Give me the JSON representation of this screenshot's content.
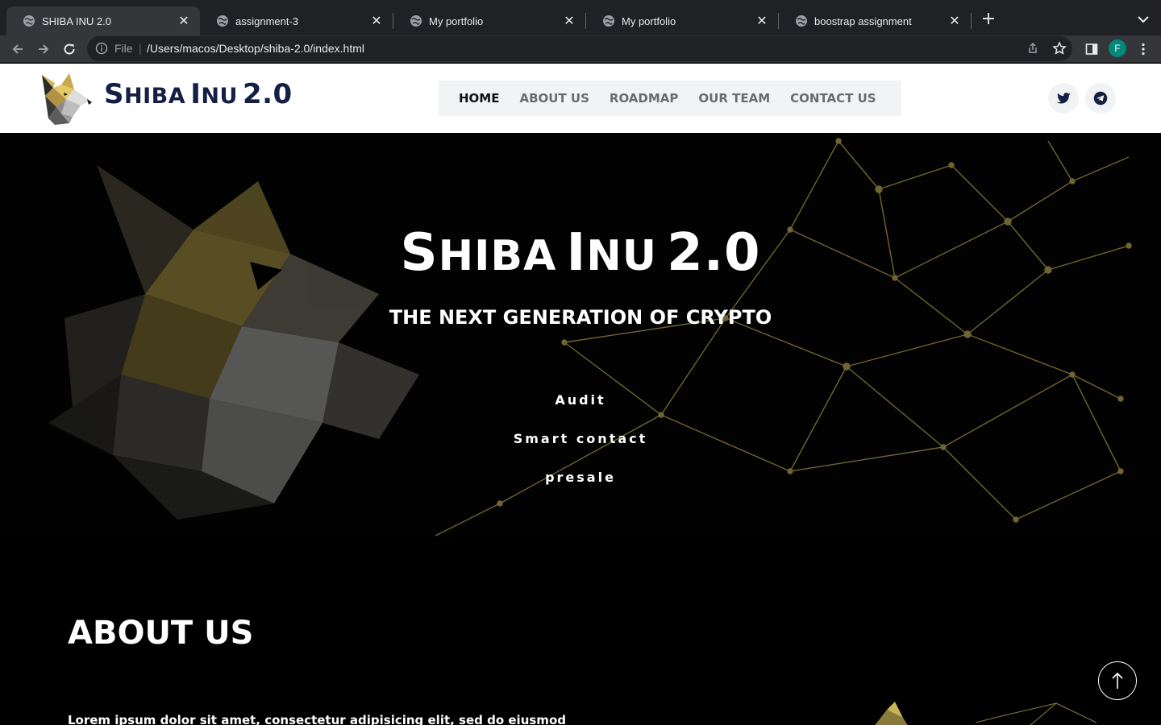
{
  "browser": {
    "tabs": [
      {
        "title": "SHIBA INU 2.0",
        "active": true
      },
      {
        "title": "assignment-3",
        "active": false
      },
      {
        "title": "My portfolio",
        "active": false
      },
      {
        "title": "My portfolio",
        "active": false
      },
      {
        "title": "boostrap assignment",
        "active": false
      }
    ],
    "omnibox": {
      "scheme_label": "File",
      "url": "/Users/macos/Desktop/shiba-2.0/index.html"
    },
    "profile_initial": "F"
  },
  "header": {
    "brand": {
      "s": "S",
      "hiba": "HIBA",
      "i": "I",
      "nu": "NU",
      "version": "2.0"
    },
    "nav": [
      {
        "label": "HOME",
        "active": true
      },
      {
        "label": "ABOUT US",
        "active": false
      },
      {
        "label": "ROADMAP",
        "active": false
      },
      {
        "label": "OUR TEAM",
        "active": false
      },
      {
        "label": "CONTACT US",
        "active": false
      }
    ],
    "social": [
      "twitter-icon",
      "telegram-icon"
    ]
  },
  "hero": {
    "title": {
      "s": "S",
      "hiba": "HIBA",
      "i": "I",
      "nu": "NU",
      "version": "2.0"
    },
    "subtitle": "THE NEXT GENERATION OF CRYPTO",
    "links": [
      "Audit",
      "Smart contact",
      "presale"
    ]
  },
  "about": {
    "title": "ABOUT US",
    "text": "Lorem ipsum dolor sit amet, consectetur adipisicing elit, sed do eiusmod"
  },
  "colors": {
    "brand_navy": "#131f44",
    "accent_gold": "#c9b45a",
    "nav_bg": "#f2f3f5",
    "chrome_dark": "#202124",
    "chrome_mid": "#35363a"
  }
}
